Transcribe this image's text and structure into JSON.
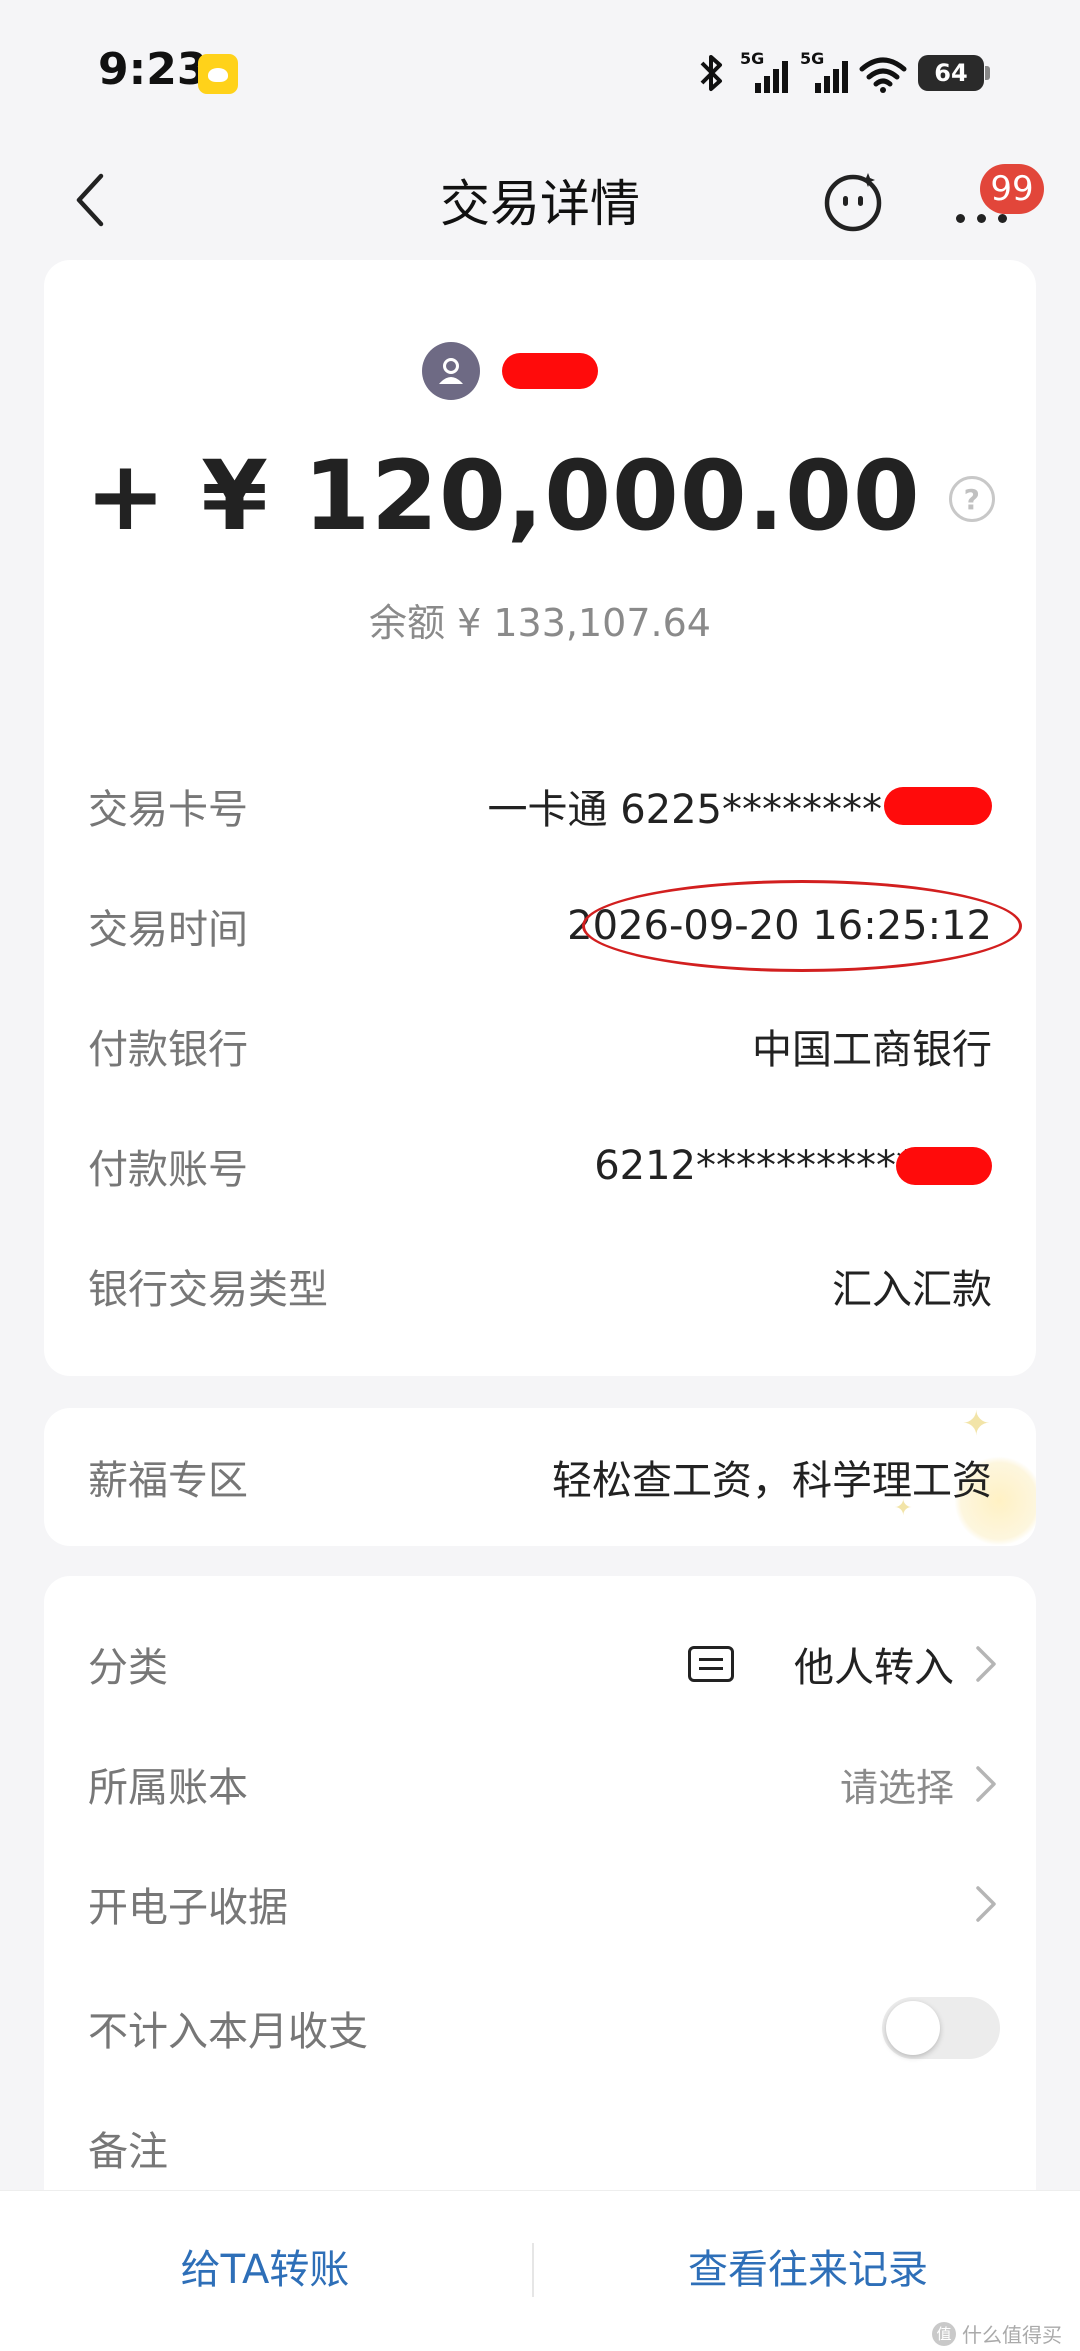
{
  "status_bar": {
    "time": "9:23",
    "network_1": "5G",
    "network_2": "5G",
    "battery": "64"
  },
  "nav": {
    "title": "交易详情",
    "message_badge": "99"
  },
  "transaction": {
    "amount": "+ ¥ 120,000.00",
    "balance": "余额 ¥ 133,107.64",
    "details": [
      {
        "label": "交易卡号",
        "value": "一卡通 6225********"
      },
      {
        "label": "交易时间",
        "value": "2026-09-20 16:25:12"
      },
      {
        "label": "付款银行",
        "value": "中国工商银行"
      },
      {
        "label": "付款账号",
        "value": "6212***********"
      },
      {
        "label": "银行交易类型",
        "value": "汇入汇款"
      }
    ]
  },
  "salary": {
    "label": "薪福专区",
    "value": "轻松查工资，科学理工资"
  },
  "options": {
    "category": {
      "label": "分类",
      "value": "他人转入"
    },
    "ledger": {
      "label": "所属账本",
      "placeholder": "请选择"
    },
    "receipt": {
      "label": "开电子收据"
    },
    "exclude": {
      "label": "不计入本月收支",
      "enabled": false
    },
    "note": {
      "label": "备注"
    }
  },
  "bottom": {
    "transfer": "给TA转账",
    "history": "查看往来记录"
  },
  "watermark": {
    "glyph": "值",
    "text": "什么值得买"
  },
  "colors": {
    "accent": "#2e6fb8",
    "badge": "#e2463a",
    "redaction": "#ff0b0b",
    "annotation": "#d21f1f"
  }
}
